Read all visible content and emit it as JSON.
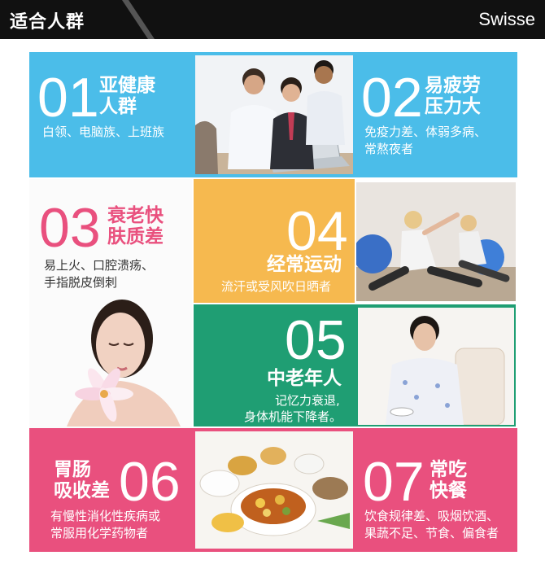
{
  "header": {
    "title": "适合人群",
    "brand": "Swisse"
  },
  "colors": {
    "blue": "#4bbde9",
    "orange": "#f6b94f",
    "green": "#1f9e73",
    "pink": "#e9507e",
    "header": "#111111"
  },
  "groups": [
    {
      "number": "01",
      "title_lines": [
        "亚健康",
        "人群"
      ],
      "desc_lines": [
        "白领、电脑族、上班族"
      ]
    },
    {
      "number": "02",
      "title_lines": [
        "易疲劳",
        "压力大"
      ],
      "desc_lines": [
        "免疫力差、体弱多病、",
        "常熬夜者"
      ]
    },
    {
      "number": "03",
      "title_lines": [
        "衰老快",
        "肤质差"
      ],
      "desc_lines": [
        "易上火、口腔溃疡、",
        "手指脱皮倒刺"
      ]
    },
    {
      "number": "04",
      "title_lines": [
        "经常运动"
      ],
      "desc_lines": [
        "流汗或受风吹日晒者"
      ]
    },
    {
      "number": "05",
      "title_lines": [
        "中老年人"
      ],
      "desc_lines": [
        "记忆力衰退,",
        "身体机能下降者。"
      ]
    },
    {
      "number": "06",
      "title_lines": [
        "胃肠",
        "吸收差"
      ],
      "desc_lines": [
        "有慢性消化性疾病或",
        "常服用化学药物者"
      ]
    },
    {
      "number": "07",
      "title_lines": [
        "常吃",
        "快餐"
      ],
      "desc_lines": [
        "饮食规律差、吸烟饮酒、",
        "果蔬不足、节食、偏食者"
      ]
    }
  ]
}
